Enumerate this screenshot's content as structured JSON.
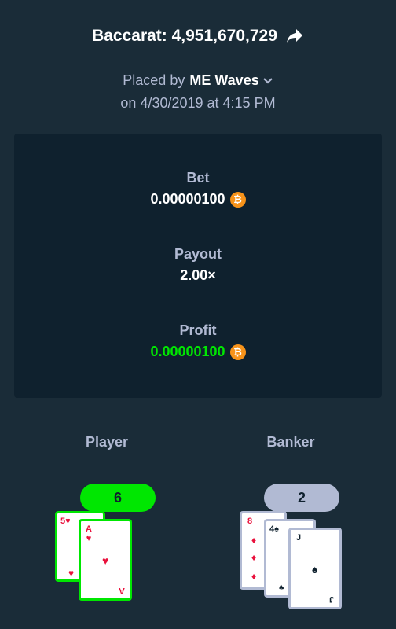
{
  "header": {
    "title": "Baccarat: 4,951,670,729"
  },
  "placed": {
    "prefix": "Placed by",
    "user": "ME Waves",
    "date": "on 4/30/2019 at 4:15 PM"
  },
  "summary": {
    "bet_label": "Bet",
    "bet_value": "0.00000100",
    "payout_label": "Payout",
    "payout_value": "2.00×",
    "profit_label": "Profit",
    "profit_value": "0.00000100",
    "currency_symbol": "₿",
    "currency_color": "#f7931a",
    "profit_color": "#00e701"
  },
  "player": {
    "label": "Player",
    "score": "6",
    "cards": [
      {
        "rank": "5",
        "suit": "♥"
      },
      {
        "rank": "A",
        "suit": "♥"
      }
    ]
  },
  "banker": {
    "label": "Banker",
    "score": "2",
    "cards": [
      {
        "rank": "8",
        "suit": "♦"
      },
      {
        "rank": "4",
        "suit": "♠"
      },
      {
        "rank": "J",
        "suit": "♠"
      }
    ]
  }
}
